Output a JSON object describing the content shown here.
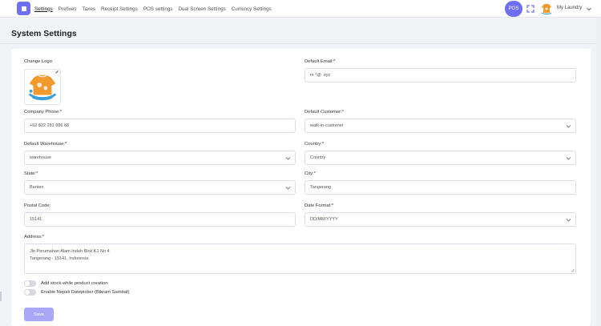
{
  "nav": {
    "items": [
      "Settings",
      "Prefixes",
      "Taxes",
      "Receipt Settings",
      "POS settings",
      "Dual Screen Settings",
      "Currency Settings"
    ],
    "active": "Settings",
    "pos_label": "POS",
    "user_name": "My Laundry"
  },
  "page": {
    "title": "System Settings"
  },
  "form": {
    "change_logo_label": "Change Logo:",
    "default_email": {
      "label": "Default Email:*",
      "value": "m           *@             .xyz"
    },
    "company_phone": {
      "label": "Company Phone:*",
      "value": "+62 822 281 886 68"
    },
    "default_customer": {
      "label": "Default Customer:*",
      "value": "walk-in-customer"
    },
    "default_warehouse": {
      "label": "Default Warehouse:*",
      "value": "warehouse"
    },
    "country": {
      "label": "Country:*",
      "value": "Country"
    },
    "state": {
      "label": "State:*",
      "value": "Banten"
    },
    "city": {
      "label": "City:*",
      "value": "Tangerang"
    },
    "postal_code": {
      "label": "Postal Code:",
      "value": "15141"
    },
    "date_format": {
      "label": "Date Format:*",
      "value": "DD/MM/YYYY"
    },
    "address": {
      "label": "Address:*",
      "line1": "Jln Perumahan Alam Indah Blok K1 No 4",
      "line2": "Tangerang - 15141, Indonesia"
    },
    "toggle_stock": "Add stock while product creation",
    "toggle_nepali": "Enable Nepali Datepicker (Bikram Sambat)",
    "save_label": "Save"
  },
  "colors": {
    "accent": "#6f6ff4",
    "save_disabled": "#a9a8f7"
  },
  "icons": [
    "logo-icon",
    "fullscreen-icon",
    "chevron-down-icon",
    "pencil-icon"
  ]
}
